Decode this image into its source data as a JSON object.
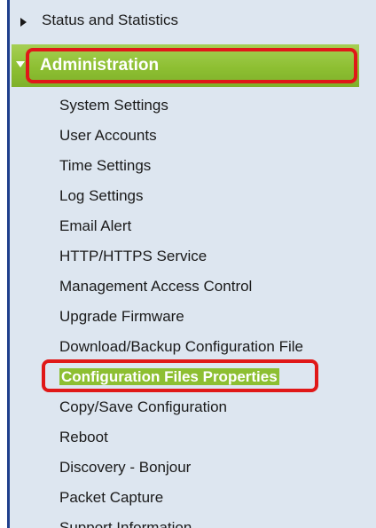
{
  "nav": {
    "status_item": {
      "label": "Status and Statistics",
      "icon": "chevron-right-icon"
    },
    "admin_item": {
      "label": "Administration",
      "icon": "chevron-down-icon",
      "accent_color": "#8dbf32"
    },
    "highlight_color": "#e01818",
    "submenu": [
      {
        "label": "System Settings"
      },
      {
        "label": "User Accounts"
      },
      {
        "label": "Time Settings"
      },
      {
        "label": "Log Settings"
      },
      {
        "label": "Email Alert"
      },
      {
        "label": "HTTP/HTTPS Service"
      },
      {
        "label": "Management Access Control"
      },
      {
        "label": "Upgrade Firmware"
      },
      {
        "label": "Download/Backup Configuration File"
      },
      {
        "label": "Configuration Files Properties",
        "selected": true
      },
      {
        "label": "Copy/Save Configuration"
      },
      {
        "label": "Reboot"
      },
      {
        "label": "Discovery - Bonjour"
      },
      {
        "label": "Packet Capture"
      },
      {
        "label": "Support Information"
      }
    ]
  }
}
